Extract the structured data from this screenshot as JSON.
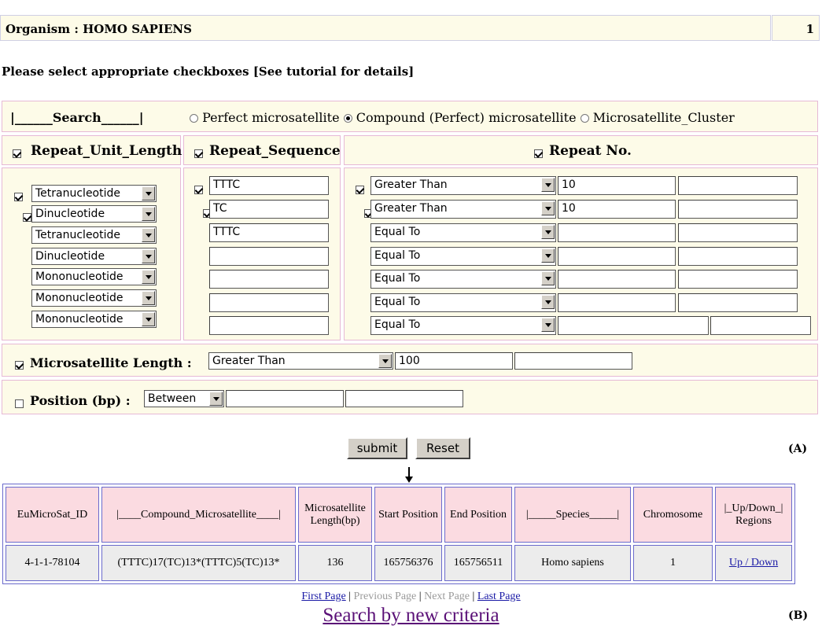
{
  "organism_label": "Organism : HOMO SAPIENS",
  "page_number": "1",
  "instruction": "Please select appropriate checkboxes [See tutorial for details]",
  "search": {
    "label": "|______Search______|",
    "options": [
      {
        "label": "Perfect microsatellite",
        "selected": false
      },
      {
        "label": "Compound (Perfect) microsatellite",
        "selected": true
      },
      {
        "label": "Microsatellite_Cluster",
        "selected": false
      }
    ]
  },
  "headers": {
    "repeat_unit_length": "Repeat_Unit_Length",
    "repeat_sequence": "Repeat_Sequence",
    "repeat_no": "Repeat No."
  },
  "unit_rows": [
    {
      "checked": true,
      "value": "Tetranucleotide"
    },
    {
      "checked": true,
      "value": "Dinucleotide"
    },
    {
      "checked": true,
      "value": "Tetranucleotide"
    },
    {
      "checked": true,
      "value": "Dinucleotide"
    },
    {
      "checked": false,
      "value": "Mononucleotide"
    },
    {
      "checked": false,
      "value": "Mononucleotide"
    },
    {
      "checked": false,
      "value": "Mononucleotide"
    }
  ],
  "sequence_rows": [
    {
      "checked": true,
      "value": "TTTC"
    },
    {
      "checked": true,
      "value": "TC"
    },
    {
      "checked": true,
      "value": "TTTC"
    },
    {
      "checked": false,
      "value": ""
    },
    {
      "checked": false,
      "value": ""
    },
    {
      "checked": false,
      "value": ""
    },
    {
      "checked": false,
      "value": ""
    }
  ],
  "repeat_rows": [
    {
      "checked": true,
      "op": "Greater Than",
      "v1": "10",
      "v2": ""
    },
    {
      "checked": true,
      "op": "Greater Than",
      "v1": "10",
      "v2": ""
    },
    {
      "checked": false,
      "op": "Equal To",
      "v1": "",
      "v2": ""
    },
    {
      "checked": false,
      "op": "Equal To",
      "v1": "",
      "v2": ""
    },
    {
      "checked": false,
      "op": "Equal To",
      "v1": "",
      "v2": ""
    },
    {
      "checked": false,
      "op": "Equal To",
      "v1": "",
      "v2": ""
    },
    {
      "checked": false,
      "op": "Equal To",
      "v1": "",
      "v2": ""
    }
  ],
  "microsatellite_length": {
    "label": "Microsatellite Length :",
    "checked": true,
    "op": "Greater Than",
    "v1": "100",
    "v2": ""
  },
  "position": {
    "label": "Position (bp) :",
    "checked": false,
    "op": "Between",
    "v1": "",
    "v2": ""
  },
  "buttons": {
    "submit": "submit",
    "reset": "Reset"
  },
  "label_a": "(A)",
  "label_b": "(B)",
  "results": {
    "headers": [
      "EuMicroSat_ID",
      "|____Compound_Microsatellite____|",
      "Microsatellite Length(bp)",
      "Start Position",
      "End Position",
      "|_____Species_____|",
      "Chromosome",
      "|_Up/Down_| Regions"
    ],
    "rows": [
      [
        "4-1-1-78104",
        "(TTTC)17(TC)13*(TTTC)5(TC)13*",
        "136",
        "165756376",
        "165756511",
        "Homo sapiens",
        "1",
        "Up / Down"
      ]
    ]
  },
  "pager": {
    "first": "First Page",
    "previous": "Previous Page",
    "next": "Next Page",
    "last": "Last Page"
  },
  "new_search": "Search by new criteria"
}
